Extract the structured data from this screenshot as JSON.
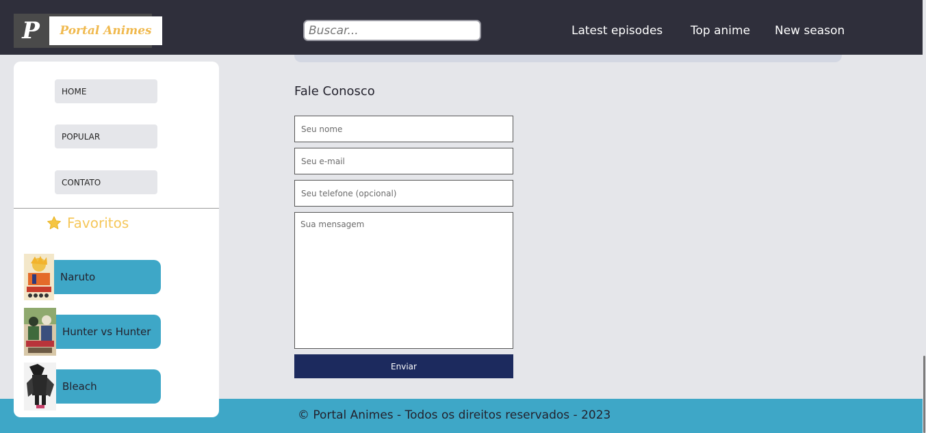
{
  "header": {
    "logo": {
      "mark": "P",
      "text": "Portal Animes"
    },
    "search": {
      "placeholder": "Buscar..."
    },
    "nav": [
      {
        "label": "Latest episodes"
      },
      {
        "label": "Top anime"
      },
      {
        "label": "New season"
      }
    ]
  },
  "sidebar": {
    "menu": [
      {
        "label": "HOME"
      },
      {
        "label": "POPULAR"
      },
      {
        "label": "CONTATO"
      }
    ],
    "favorites": {
      "title": "Favoritos",
      "icon": "star-icon",
      "items": [
        {
          "label": "Naruto",
          "thumb_color": "#d9733a"
        },
        {
          "label": "Hunter vs Hunter",
          "thumb_color": "#4a7a4c"
        },
        {
          "label": "Bleach",
          "thumb_color": "#2a2a2a"
        }
      ]
    }
  },
  "contact": {
    "title": "Fale Conosco",
    "fields": {
      "name_placeholder": "Seu nome",
      "email_placeholder": "Seu e-mail",
      "phone_placeholder": "Seu telefone (opcional)",
      "message_placeholder": "Sua mensagem"
    },
    "submit_label": "Enviar"
  },
  "footer": {
    "text": "© Portal Animes - Todos os direitos reservados - 2023"
  },
  "colors": {
    "header_bg": "#2f2f3b",
    "page_bg": "#e5e6ea",
    "accent_teal": "#3ea7c7",
    "favorites_gold": "#f5c75a",
    "submit_navy": "#1c2a5e"
  }
}
